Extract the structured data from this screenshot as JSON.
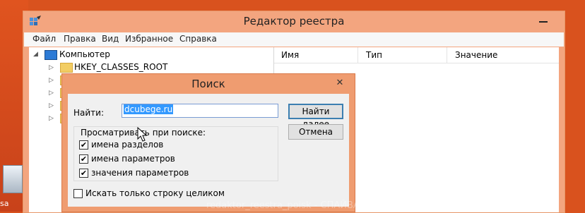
{
  "desktop": {
    "icon_label": "sa",
    "watermark": "redaktor_reestra_poisk - СПАЙВАРЕ.ру"
  },
  "registry_window": {
    "title": "Редактор реестра",
    "menu": [
      "Файл",
      "Правка",
      "Вид",
      "Избранное",
      "Справка"
    ],
    "tree": {
      "root": "Компьютер",
      "first_key": "HKEY_CLASSES_ROOT"
    },
    "columns": [
      "Имя",
      "Тип",
      "Значение"
    ]
  },
  "find_dialog": {
    "title": "Поиск",
    "find_label": "Найти:",
    "find_value": "dcubege.ru",
    "find_next": "Найти далее",
    "cancel": "Отмена",
    "scope_label": "Просматривать при поиске:",
    "options": [
      {
        "label": "имена разделов",
        "checked": true
      },
      {
        "label": "имена параметров",
        "checked": true
      },
      {
        "label": "значения параметров",
        "checked": true
      }
    ],
    "whole_string": {
      "label": "Искать только строку целиком",
      "checked": false
    },
    "close_glyph": "✕",
    "check_glyph": "✔"
  }
}
